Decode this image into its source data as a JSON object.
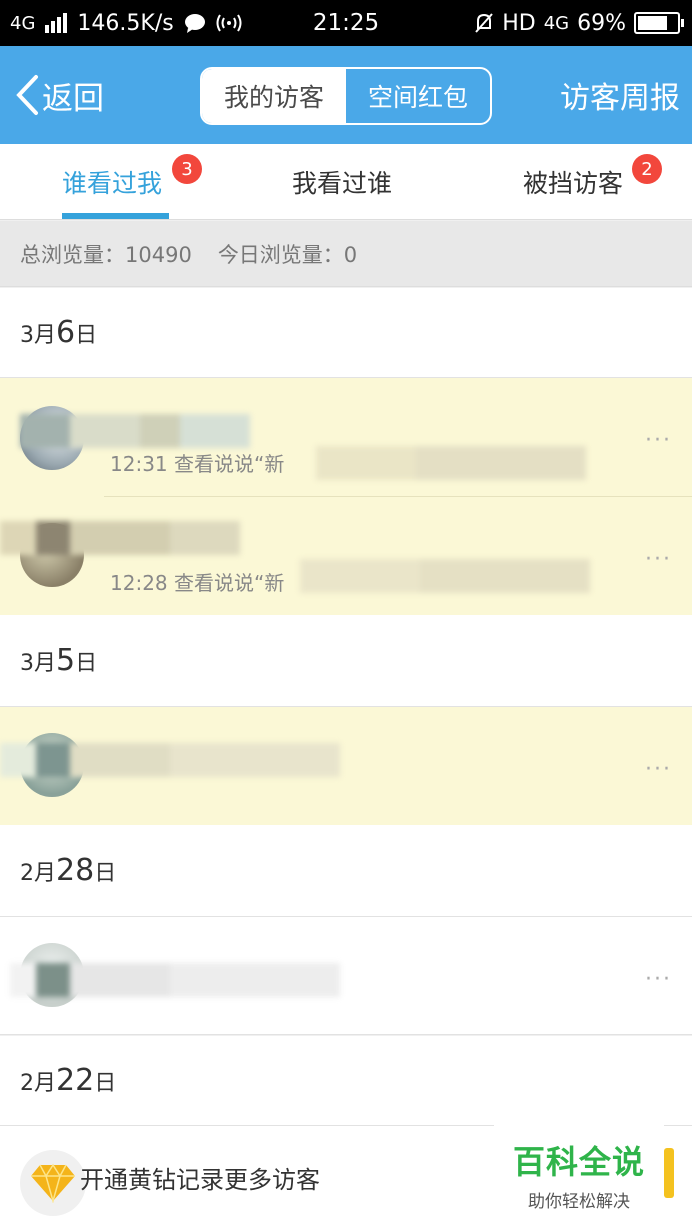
{
  "status_bar": {
    "network": "4G",
    "speed": "146.5K/s",
    "time": "21:25",
    "hd": "HD",
    "net2": "4G",
    "battery": "69%"
  },
  "header": {
    "back_label": "返回",
    "seg_active": "我的访客",
    "seg_inactive": "空间红包",
    "weekly_label": "访客周报"
  },
  "tabs": [
    {
      "label": "谁看过我",
      "badge": "3"
    },
    {
      "label": "我看过谁",
      "badge": ""
    },
    {
      "label": "被挡访客",
      "badge": "2"
    }
  ],
  "stats": {
    "total": "总浏览量：10490",
    "today": "今日浏览量：0"
  },
  "groups": [
    {
      "month": "3月",
      "day": "6",
      "suffix": "日",
      "items": [
        {
          "text": "12:31 查看说说“新"
        },
        {
          "text": "12:28 查看说说“新"
        }
      ]
    },
    {
      "month": "3月",
      "day": "5",
      "suffix": "日",
      "items": [
        {
          "text": ""
        }
      ]
    },
    {
      "month": "2月",
      "day": "28",
      "suffix": "日",
      "items": [
        {
          "text": ""
        }
      ]
    },
    {
      "month": "2月",
      "day": "22",
      "suffix": "日",
      "items": []
    }
  ],
  "more_icon": "···",
  "promo": {
    "icon": "diamond-icon",
    "text": "开通黄钻记录更多访客"
  },
  "watermark": {
    "title": "百科全说",
    "subtitle": "助你轻松解决"
  },
  "colors": {
    "header_blue": "#4aa8e8",
    "tab_active": "#35a2db",
    "badge_red": "#f2473c",
    "row_yellow": "#fbf8d6",
    "watermark_green": "#2fb44a"
  }
}
